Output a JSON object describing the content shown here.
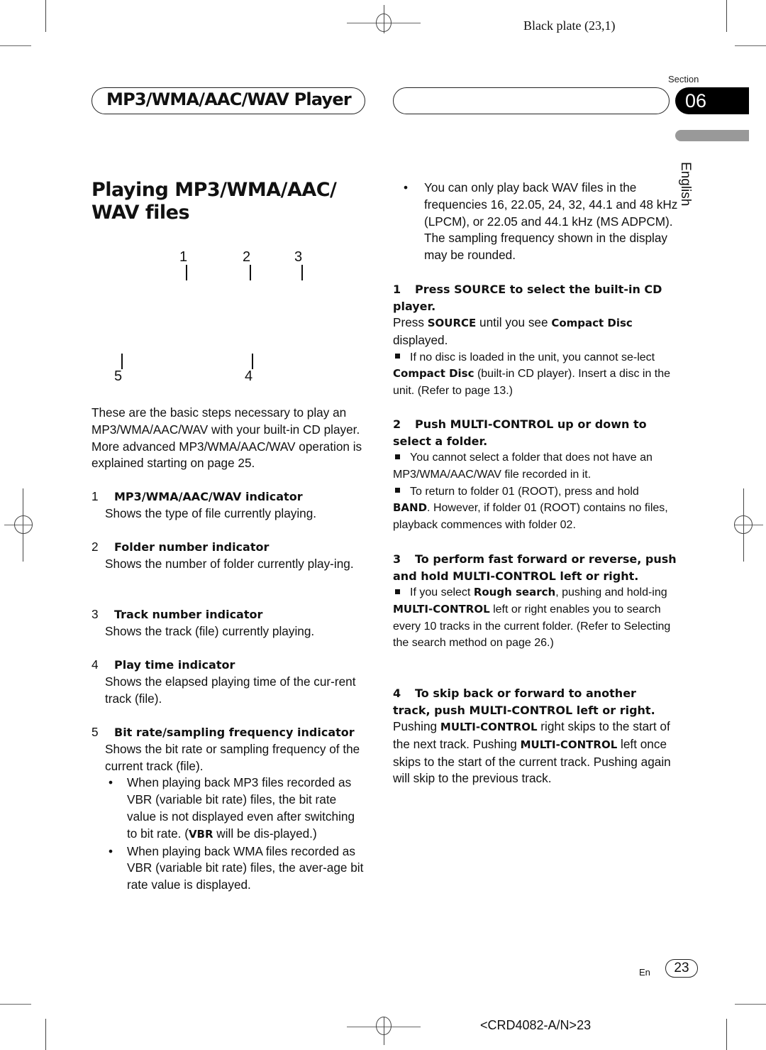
{
  "print_marks": {
    "plate_label": "Black plate (23,1)",
    "footer_code": "<CRD4082-A/N>23"
  },
  "header": {
    "chapter_title": "MP3/WMA/AAC/WAV Player",
    "section_label": "Section",
    "section_number": "06",
    "language_tab": "English"
  },
  "left_column": {
    "heading": "Playing MP3/WMA/AAC/ WAV files",
    "heading_line1": "Playing MP3/WMA/AAC/",
    "heading_line2": "WAV files",
    "display_callouts": [
      "1",
      "2",
      "3",
      "4",
      "5"
    ],
    "intro": "These are the basic steps necessary to play an MP3/WMA/AAC/WAV with your built-in CD player. More advanced MP3/WMA/AAC/WAV operation is explained starting on page 25.",
    "items": [
      {
        "num": "1",
        "title": "MP3/WMA/AAC/WAV indicator",
        "desc": "Shows the type of file currently playing."
      },
      {
        "num": "2",
        "title": "Folder number indicator",
        "desc": "Shows the number of folder currently play-ing."
      },
      {
        "num": "3",
        "title": "Track number indicator",
        "desc": "Shows the track (file) currently playing."
      },
      {
        "num": "4",
        "title": "Play time indicator",
        "desc": "Shows the elapsed playing time of the cur-rent track (file)."
      },
      {
        "num": "5",
        "title": "Bit rate/sampling frequency indicator",
        "desc": "Shows the bit rate or sampling frequency of the current track (file)."
      }
    ],
    "item5_bullets": [
      {
        "pre": "When playing back MP3 files recorded as VBR (variable bit rate) files, the bit rate value is not displayed even after switching to bit rate. (",
        "bold": "VBR",
        "post": " will be dis-played.)"
      },
      {
        "pre": "When playing back WMA files recorded as VBR (variable bit rate) files, the aver-age bit rate value is displayed.",
        "bold": "",
        "post": ""
      }
    ],
    "bullet_glyph": "•"
  },
  "right_column": {
    "top_bullet": "You can only play back WAV files in the frequencies 16, 22.05, 24, 32, 44.1 and 48 kHz (LPCM), or 22.05 and 44.1 kHz (MS ADPCM). The sampling frequency shown in the display may be rounded.",
    "steps": [
      {
        "num": "1",
        "title": "Press SOURCE to select the built-in CD player.",
        "body": {
          "t1": "Press ",
          "b1": "SOURCE",
          "t2": " until you see ",
          "b2": "Compact Disc",
          "t3": " displayed."
        },
        "notes": [
          {
            "t1": "If no disc is loaded in the unit, you cannot se-lect ",
            "b1": "Compact Disc",
            "t2": " (built-in CD player). Insert a disc in the unit. (Refer to page 13.)"
          }
        ]
      },
      {
        "num": "2",
        "title": "Push MULTI-CONTROL up or down to select a folder.",
        "notes": [
          {
            "t1": "You cannot select a folder that does not have an MP3/WMA/AAC/WAV file recorded in it.",
            "b1": "",
            "t2": ""
          },
          {
            "t1": "To return to folder 01 (ROOT), press and hold ",
            "b1": "BAND",
            "t2": ". However, if folder 01 (ROOT) contains no files, playback commences with folder 02."
          }
        ]
      },
      {
        "num": "3",
        "title": "To perform fast forward or reverse, push and hold MULTI-CONTROL left or right.",
        "notes": [
          {
            "t1": "If you select ",
            "b1": "Rough search",
            "t2": ", pushing and hold-ing ",
            "b2": "MULTI-CONTROL",
            "t3": " left or right enables you to search every 10 tracks in the current folder. (Refer to Selecting the search method on page 26.)"
          }
        ]
      },
      {
        "num": "4",
        "title": "To skip back or forward to another track, push MULTI-CONTROL left or right.",
        "body": {
          "t1": "Pushing ",
          "b1": "MULTI-CONTROL",
          "t2": " right skips to the start of the next track. Pushing ",
          "b2": "MULTI-CONTROL",
          "t3": " left once skips to the start of the current track. Pushing again will skip to the previous track."
        }
      }
    ]
  },
  "footer": {
    "lang_code": "En",
    "page_number": "23"
  }
}
